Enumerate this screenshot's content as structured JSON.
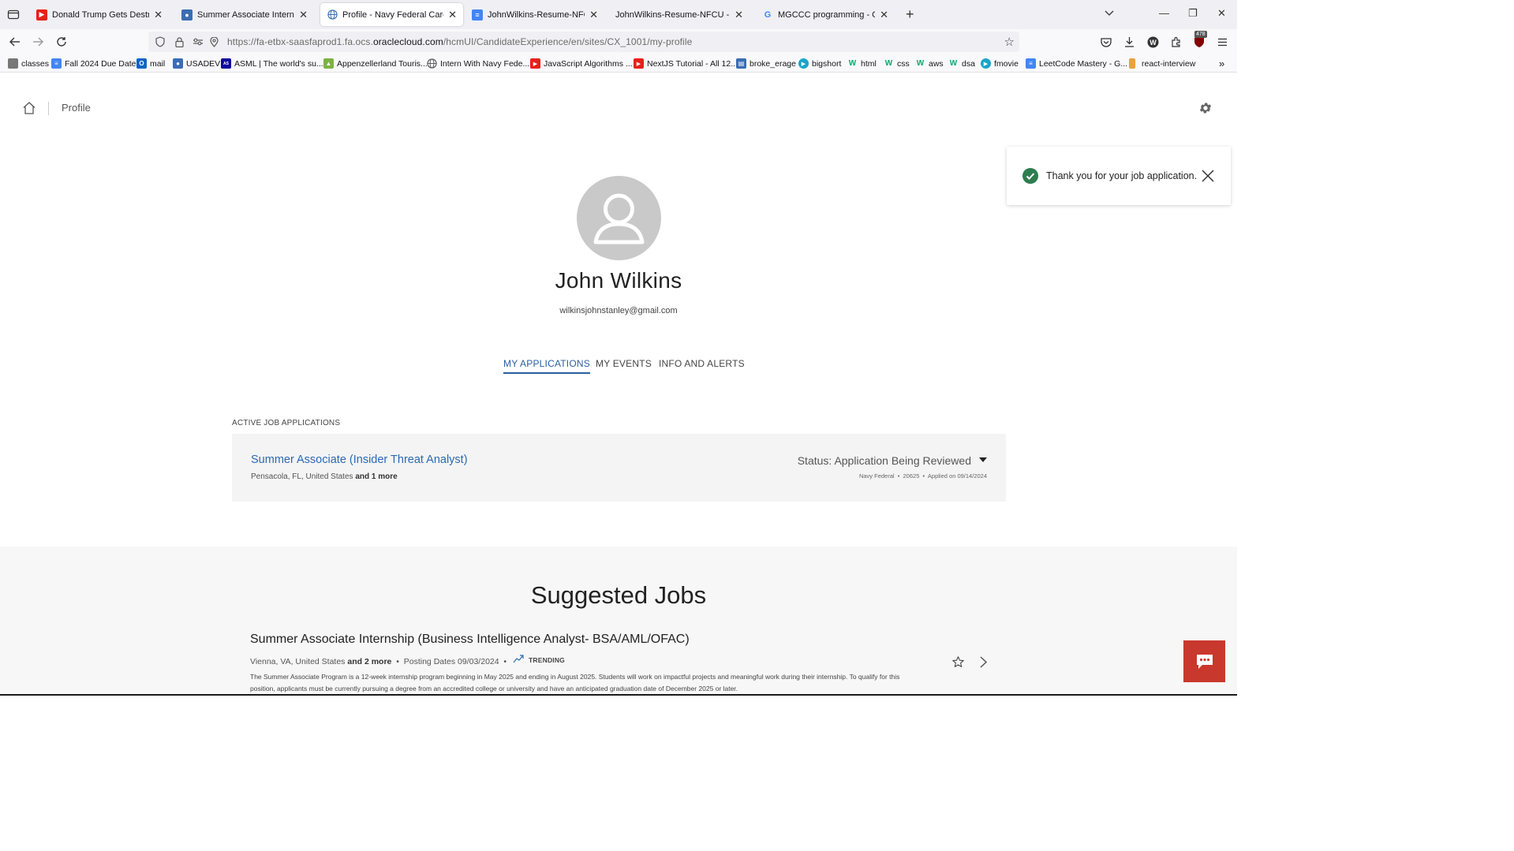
{
  "browser": {
    "tabs": [
      {
        "title": "Donald Trump Gets Destroyed in",
        "active": false,
        "favicon": "youtube-icon"
      },
      {
        "title": "Summer Associate Internship (F",
        "active": false,
        "favicon": "careers-icon"
      },
      {
        "title": "Profile - Navy Federal Careers",
        "active": true,
        "favicon": "globe-icon"
      },
      {
        "title": "JohnWilkins-Resume-NFCU - Go",
        "active": false,
        "favicon": "google-docs-icon"
      },
      {
        "title": "JohnWilkins-Resume-NFCU - JohnW",
        "active": false,
        "favicon": "none"
      },
      {
        "title": "MGCCC programming - Google",
        "active": false,
        "favicon": "google-icon"
      }
    ],
    "url_prefix": "https://fa-etbx-saasfaprod1.fa.ocs.",
    "url_host": "oraclecloud.com",
    "url_suffix": "/hcmUI/CandidateExperience/en/sites/CX_1001/my-profile",
    "extension_badge": "478",
    "bookmarks": [
      {
        "label": "classes",
        "icon": "bag-icon",
        "color": "#555555"
      },
      {
        "label": "Fall 2024 Due Dates",
        "icon": "docs-icon",
        "color": "#4285f4"
      },
      {
        "label": "mail",
        "icon": "outlook-icon",
        "color": "#0a64c8"
      },
      {
        "label": "USADEV",
        "icon": "people-icon",
        "color": "#3b6db3"
      },
      {
        "label": "ASML | The world's su...",
        "icon": "asml-icon",
        "color": "#10069f"
      },
      {
        "label": "Appenzellerland Touris...",
        "icon": "map-icon",
        "color": "#7cb342"
      },
      {
        "label": "Intern With Navy Fede...",
        "icon": "globe-icon",
        "color": "#555555"
      },
      {
        "label": "JavaScript Algorithms ...",
        "icon": "youtube-icon",
        "color": "#e62117"
      },
      {
        "label": "NextJS Tutorial - All 12...",
        "icon": "youtube-icon",
        "color": "#e62117"
      },
      {
        "label": "broke_erage",
        "icon": "chart-icon",
        "color": "#3b6db3"
      },
      {
        "label": "bigshort",
        "icon": "play-icon",
        "color": "#1aa5c9"
      },
      {
        "label": "html",
        "icon": "w3-icon",
        "color": "#04aa6d"
      },
      {
        "label": "css",
        "icon": "w3-icon",
        "color": "#04aa6d"
      },
      {
        "label": "aws",
        "icon": "w3-icon",
        "color": "#04aa6d"
      },
      {
        "label": "dsa",
        "icon": "w3-icon",
        "color": "#04aa6d"
      },
      {
        "label": "fmovie",
        "icon": "play-icon",
        "color": "#1aa5c9"
      },
      {
        "label": "LeetCode Mastery - G...",
        "icon": "docs-icon",
        "color": "#4285f4"
      },
      {
        "label": "react-interview",
        "icon": "file-icon",
        "color": "#e8a33c"
      }
    ]
  },
  "header": {
    "breadcrumb": "Profile"
  },
  "toast": {
    "message": "Thank you for your job application."
  },
  "profile": {
    "name": "John Wilkins",
    "email": "wilkinsjohnstanley@gmail.com"
  },
  "profile_tabs": [
    {
      "label": "MY APPLICATIONS",
      "active": true
    },
    {
      "label": "MY EVENTS",
      "active": false
    },
    {
      "label": "INFO AND ALERTS",
      "active": false
    }
  ],
  "applications": {
    "section_label": "ACTIVE JOB APPLICATIONS",
    "items": [
      {
        "title": "Summer Associate (Insider Threat Analyst)",
        "location": "Pensacola, FL, United States",
        "location_more": "and 1 more",
        "status_label": "Status:",
        "status": "Application Being Reviewed",
        "org": "Navy Federal",
        "req_id": "20625",
        "applied": "Applied on 09/14/2024"
      }
    ]
  },
  "suggested": {
    "heading": "Suggested Jobs",
    "jobs": [
      {
        "title": "Summer Associate Internship (Business Intelligence Analyst- BSA/AML/OFAC)",
        "location": "Vienna, VA, United States",
        "location_more": "and 2 more",
        "posting": "Posting Dates 09/03/2024",
        "badge": "TRENDING",
        "description": "The Summer Associate Program is a 12-week internship program beginning in May 2025 and ending in August 2025. Students will work on impactful projects and meaningful work during their internship. To qualify for this position, applicants must be currently pursuing a degree from an accredited college or university and have an anticipated graduation date of December 2025 or later."
      }
    ]
  },
  "colors": {
    "accent": "#2a5d9f",
    "link": "#2a6ab3",
    "success": "#2e7d4f",
    "chat": "#c9382c"
  }
}
